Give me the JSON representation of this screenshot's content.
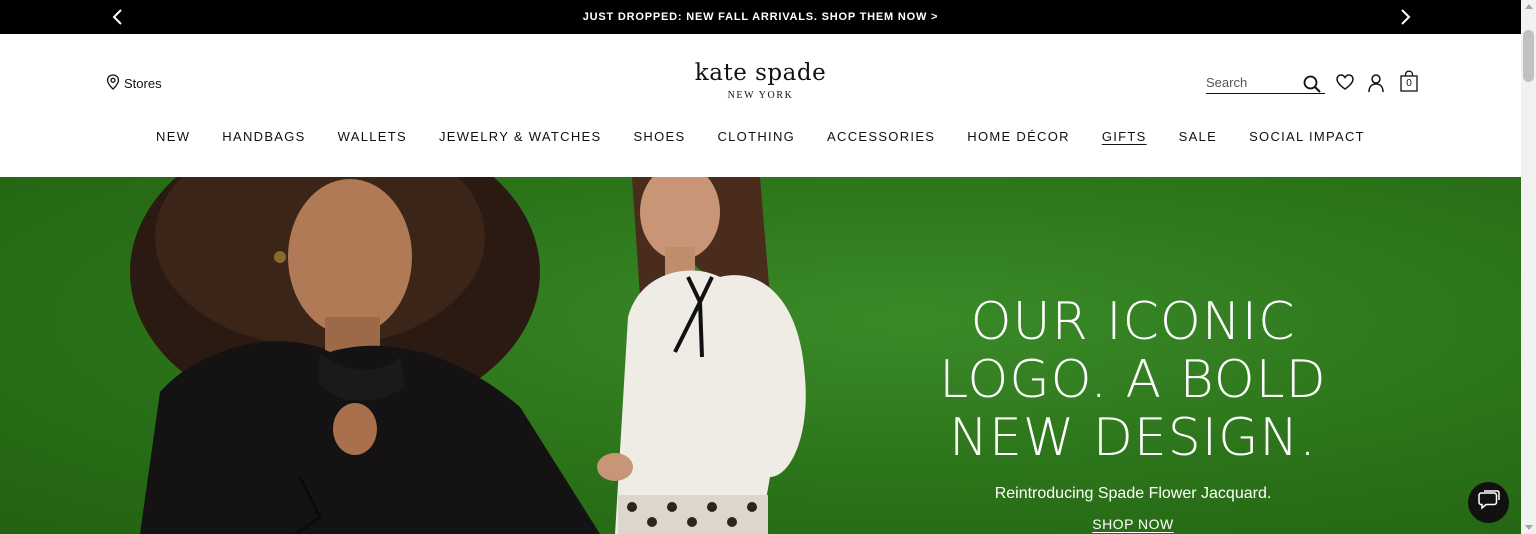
{
  "promo": {
    "text": "JUST DROPPED: NEW FALL ARRIVALS. SHOP THEM NOW >",
    "prev_icon": "chevron-left-icon",
    "next_icon": "chevron-right-icon"
  },
  "header": {
    "stores_label": "Stores",
    "logo_main": "kate spade",
    "logo_sub": "NEW YORK",
    "search_placeholder": "Search",
    "bag_count": "0"
  },
  "nav": {
    "items": [
      "NEW",
      "HANDBAGS",
      "WALLETS",
      "JEWELRY & WATCHES",
      "SHOES",
      "CLOTHING",
      "ACCESSORIES",
      "HOME DÉCOR",
      "GIFTS",
      "SALE",
      "SOCIAL IMPACT"
    ],
    "active": "GIFTS"
  },
  "hero": {
    "heading_lines": [
      "OUR ICONIC",
      "LOGO. A BOLD",
      "NEW DESIGN."
    ],
    "subheading": "Reintroducing Spade Flower Jacquard.",
    "cta": "SHOP NOW",
    "background_color": "#2e7a1e"
  },
  "colors": {
    "promo_bg": "#000000",
    "text": "#111111",
    "hero_green": "#2e7a1e"
  }
}
